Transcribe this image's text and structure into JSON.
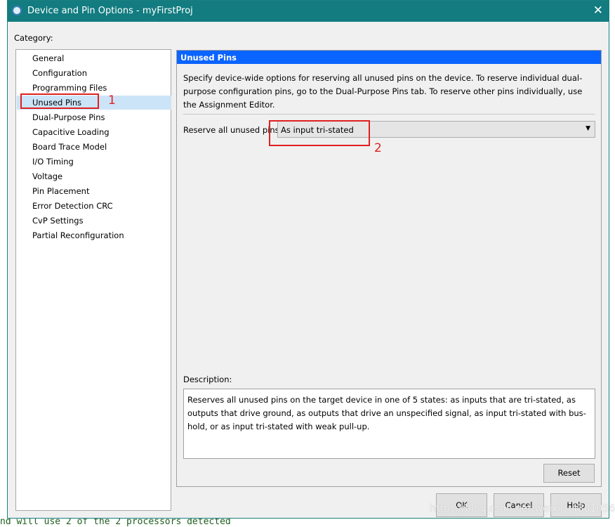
{
  "window": {
    "title": "Device and Pin Options - myFirstProj",
    "close_icon": "close-icon",
    "app_icon": "quartus-icon"
  },
  "category_label": "Category:",
  "categories": [
    "General",
    "Configuration",
    "Programming Files",
    "Unused Pins",
    "Dual-Purpose Pins",
    "Capacitive Loading",
    "Board Trace Model",
    "I/O Timing",
    "Voltage",
    "Pin Placement",
    "Error Detection CRC",
    "CvP Settings",
    "Partial Reconfiguration"
  ],
  "selected_category": "Unused Pins",
  "panel": {
    "header": "Unused Pins",
    "intro": "Specify device-wide options for reserving all unused pins on the device. To reserve individual dual-purpose configuration pins, go to the Dual-Purpose Pins tab. To reserve other pins individually, use the Assignment Editor.",
    "reserve_label": "Reserve all unused pins:",
    "reserve_value": "As input tri-stated",
    "description_label": "Description:",
    "description": "Reserves all unused pins on the target device in one of 5 states: as inputs that are tri-stated, as outputs that drive ground, as outputs that drive an unspecified signal, as input tri-stated with bus-hold, or as input tri-stated with weak pull-up.",
    "reset": "Reset"
  },
  "buttons": {
    "ok": "OK",
    "cancel": "Cancel",
    "help": "Help"
  },
  "annotations": {
    "one": "1",
    "two": "2",
    "color": "#e02020"
  },
  "background_text": "nd will use 2 of the 2 processors detected",
  "watermark": "https://blog.csdn.net/weixin_43810563",
  "colors": {
    "titlebar": "#127c80",
    "header": "#0a64ff",
    "selection": "#cce4f7"
  }
}
